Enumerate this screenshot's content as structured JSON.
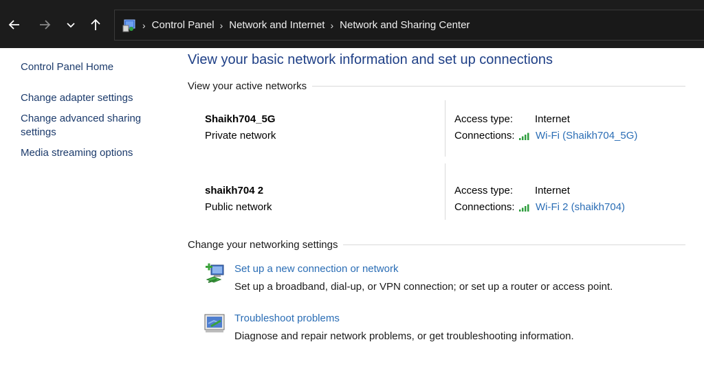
{
  "toolbar": {
    "back_icon": "arrow-left-icon",
    "forward_icon": "arrow-right-icon",
    "recent_icon": "chevron-down-icon",
    "up_icon": "arrow-up-icon"
  },
  "breadcrumb": {
    "items": [
      "Control Panel",
      "Network and Internet",
      "Network and Sharing Center"
    ]
  },
  "sidebar": {
    "home": "Control Panel Home",
    "links": [
      "Change adapter settings",
      "Change advanced sharing settings",
      "Media streaming options"
    ]
  },
  "main": {
    "title": "View your basic network information and set up connections",
    "active_header": "View your active networks",
    "access_label": "Access type:",
    "connections_label": "Connections:",
    "networks": [
      {
        "name": "Shaikh704_5G",
        "type": "Private network",
        "access": "Internet",
        "connection": "Wi-Fi (Shaikh704_5G)"
      },
      {
        "name": "shaikh704 2",
        "type": "Public network",
        "access": "Internet",
        "connection": "Wi-Fi 2 (shaikh704)"
      }
    ],
    "settings_header": "Change your networking settings",
    "tasks": [
      {
        "link": "Set up a new connection or network",
        "desc": "Set up a broadband, dial-up, or VPN connection; or set up a router or access point."
      },
      {
        "link": "Troubleshoot problems",
        "desc": "Diagnose and repair network problems, or get troubleshooting information."
      }
    ]
  },
  "colors": {
    "topbar": "#1c1c1c",
    "title": "#1e3f86",
    "link": "#2a6db5",
    "signal": "#2e9e3e"
  }
}
